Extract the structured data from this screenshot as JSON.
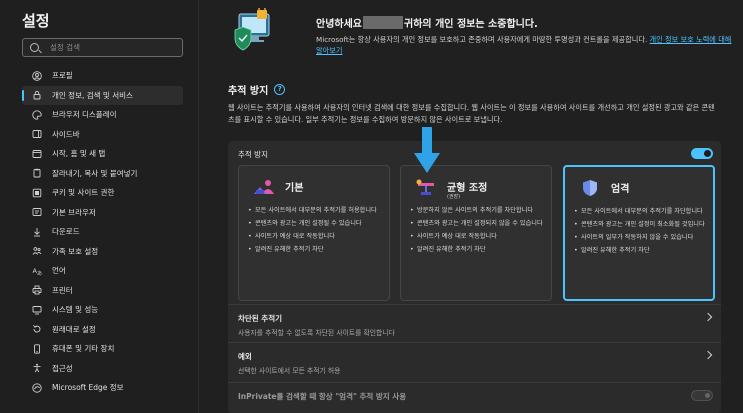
{
  "sidebar": {
    "title": "설정",
    "search_placeholder": "설정 검색",
    "items": [
      {
        "label": "프로필",
        "icon": "profile-icon"
      },
      {
        "label": "개인 정보, 검색 및 서비스",
        "icon": "lock-icon",
        "active": true
      },
      {
        "label": "브라우저 디스플레이",
        "icon": "palette-icon"
      },
      {
        "label": "사이드바",
        "icon": "sidebar-icon"
      },
      {
        "label": "시작, 홈 및 새 탭",
        "icon": "home-icon"
      },
      {
        "label": "잘라내기, 복사 및 붙여넣기",
        "icon": "clipboard-icon"
      },
      {
        "label": "쿠키 및 사이트 권한",
        "icon": "cookie-icon"
      },
      {
        "label": "기본 브라우저",
        "icon": "browser-icon"
      },
      {
        "label": "다운로드",
        "icon": "download-icon"
      },
      {
        "label": "가족 보호 설정",
        "icon": "family-icon"
      },
      {
        "label": "언어",
        "icon": "language-icon"
      },
      {
        "label": "프린터",
        "icon": "printer-icon"
      },
      {
        "label": "시스템 및 성능",
        "icon": "system-icon"
      },
      {
        "label": "원래대로 설정",
        "icon": "reset-icon"
      },
      {
        "label": "휴대폰 및 기타 장치",
        "icon": "phone-icon"
      },
      {
        "label": "접근성",
        "icon": "accessibility-icon"
      },
      {
        "label": "Microsoft Edge 정보",
        "icon": "edge-icon"
      }
    ]
  },
  "hero": {
    "title_prefix": "안녕하세요",
    "title_suffix": "귀하의 개인 정보는 소중합니다.",
    "desc": "Microsoft는 항상 사용자의 개인 정보를 보호하고 존중하며 사용자에게 마땅한 투명성과 컨트롤을 제공합니다.",
    "link": "개인 정보 보호 노력에 대해 알아보기"
  },
  "tracking": {
    "section_title": "추적 방지",
    "help": "?",
    "description": "웹 사이트는 추적기를 사용하여 사용자의 인터넷 검색에 대한 정보를 수집합니다. 웹 사이트는 이 정보를 사용하여 사이트를 개선하고 개인 설정된 광고와 같은 콘텐츠를 표시할 수 있습니다. 일부 추적기는 정보를 수집하여 방문하지 않은 사이트로 보냅니다.",
    "toggle_label": "추적 방지",
    "toggle_on": true,
    "options": [
      {
        "title": "기본",
        "subtitle": "",
        "selected": false,
        "bullets": [
          "모든 사이트에서 대부분의 추적기를 허용합니다",
          "콘텐츠와 광고는 개인 설정될 수 있습니다",
          "사이트가 예상 대로 작동합니다",
          "알려진 유해한 추적기 차단"
        ]
      },
      {
        "title": "균형 조정",
        "subtitle": "(권장)",
        "selected": false,
        "bullets": [
          "방문하지 않은 사이트의 추적기를 차단합니다",
          "콘텐츠와 광고는 개인 설정되지 않을 수 있습니다",
          "사이트가 예상 대로 작동합니다",
          "알려진 유해한 추적기 차단"
        ]
      },
      {
        "title": "엄격",
        "subtitle": "",
        "selected": true,
        "bullets": [
          "모든 사이트에서 대부분의 추적기를 차단합니다",
          "콘텐츠와 광고는 개인 설정이 최소화될 것입니다",
          "사이트의 일부가 작동하지 않을 수 있습니다",
          "알려진 유해한 추적기 차단"
        ]
      }
    ],
    "rows": [
      {
        "title": "차단된 추적기",
        "desc": "사용자를 추적할 수 없도록 차단된 사이트를 확인합니다"
      },
      {
        "title": "예외",
        "desc": "선택한 사이트에서 모든 추적기 허용"
      }
    ],
    "inprivate_label": "InPrivate를 검색할 때 항상 \"엄격\" 추적 방지 사용",
    "inprivate_on": false
  },
  "colors": {
    "accent": "#4cc2ff",
    "background": "#202020",
    "card": "#2b2b2b"
  }
}
